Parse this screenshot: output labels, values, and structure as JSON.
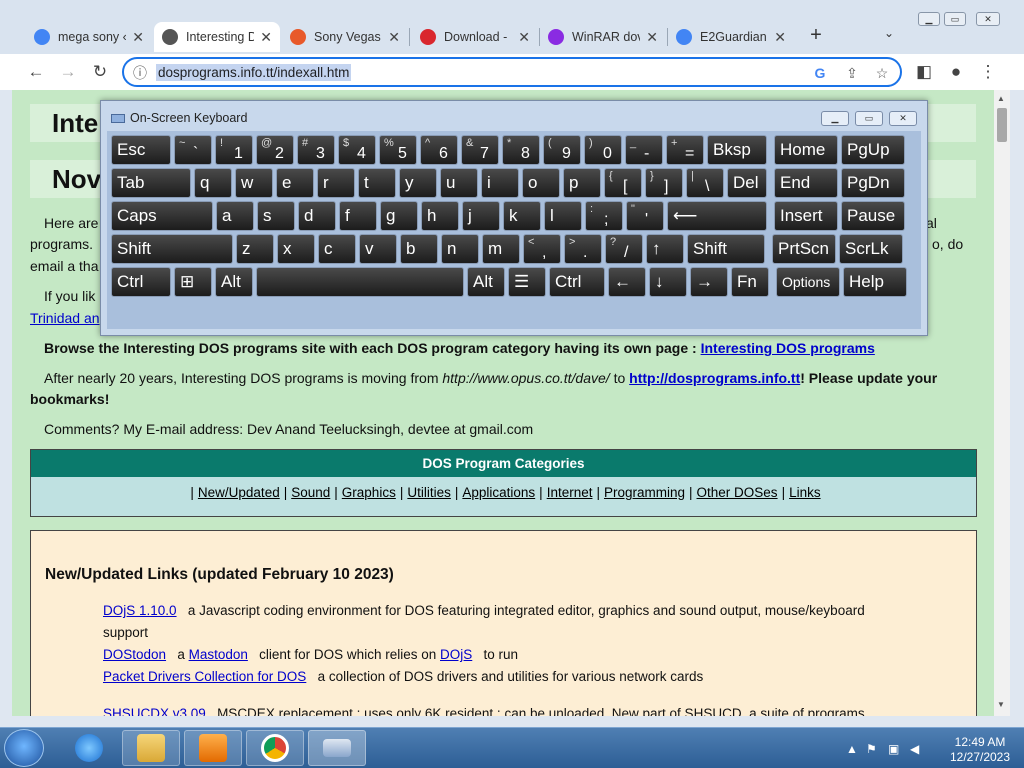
{
  "browser": {
    "tabs": [
      {
        "label": "mega sony «",
        "icon": "google-icon",
        "color": "#4285f4"
      },
      {
        "label": "Interesting D",
        "icon": "globe-icon",
        "color": "#555555",
        "active": true
      },
      {
        "label": "Sony Vegas",
        "icon": "download-icon",
        "color": "#e8592a"
      },
      {
        "label": "Download -",
        "icon": "mega-icon",
        "color": "#d9272e"
      },
      {
        "label": "WinRAR dov",
        "icon": "winrar-icon",
        "color": "#8a2be2"
      },
      {
        "label": "E2Guardian",
        "icon": "google-icon",
        "color": "#4285f4"
      }
    ],
    "new_tab": "+",
    "tab_list": "⌄",
    "url": "dosprograms.info.tt/indexall.htm"
  },
  "page": {
    "banner1": "Inte",
    "banner2": "Nov",
    "intro_start": "Here are",
    "intro_end": "al",
    "intro2_start": "programs.",
    "intro2_end": "o, do",
    "intro3": "email a tha",
    "ifyou": "If you lik",
    "trinidad": "Trinidad an",
    "browse_text": "Browse the Interesting DOS programs site with each DOS program category having its own page :",
    "browse_link": "Interesting DOS programs",
    "moving_text1": "After nearly 20 years, Interesting DOS programs is moving from",
    "moving_old_url": "http://www.opus.co.tt/dave/",
    "moving_to": "to",
    "moving_link": "http://dosprograms.info.tt",
    "moving_text2": "! Please update your",
    "moving_text3": "bookmarks!",
    "comments": "Comments? My E-mail address: Dev Anand Teelucksingh, devtee at gmail.com",
    "categories_title": "DOS Program Categories",
    "categories": [
      "New/Updated",
      "Sound",
      "Graphics",
      "Utilities",
      "Applications",
      "Internet",
      "Programming",
      "Other DOSes",
      "Links"
    ],
    "new_heading": "New/Updated Links (updated February 10 2023)",
    "entries": [
      {
        "link": "DOjS 1.10.0",
        "text": "a Javascript coding environment for DOS featuring integrated editor, graphics and sound output, mouse/keyboard"
      },
      {
        "link": "",
        "text": "support"
      },
      {
        "link": "DOStodon",
        "text": "a",
        "link2": "Mastodon",
        "text2": "client for DOS which relies on",
        "link3": "DOjS",
        "text3": "to run"
      },
      {
        "link": "Packet Drivers Collection for DOS",
        "text": "a collection of DOS drivers and utilities for various network cards"
      },
      {
        "link": "SHSUCDX v3.09",
        "text": "MSCDEX replacement : uses only 6K resident : can be unloaded. New part of SHSUCD, a suite of programs"
      }
    ]
  },
  "osk": {
    "title": "On-Screen Keyboard",
    "rows": [
      [
        {
          "k": "Esc"
        },
        {
          "s": "~",
          "m": "`"
        },
        {
          "s": "!",
          "m": "1"
        },
        {
          "s": "@",
          "m": "2"
        },
        {
          "s": "#",
          "m": "3"
        },
        {
          "s": "$",
          "m": "4"
        },
        {
          "s": "%",
          "m": "5"
        },
        {
          "s": "^",
          "m": "6"
        },
        {
          "s": "&",
          "m": "7"
        },
        {
          "s": "*",
          "m": "8"
        },
        {
          "s": "(",
          "m": "9"
        },
        {
          "s": ")",
          "m": "0"
        },
        {
          "s": "_",
          "m": "-"
        },
        {
          "s": "+",
          "m": "="
        },
        {
          "k": "Bksp"
        },
        {
          "k": "Home"
        },
        {
          "k": "PgUp"
        }
      ],
      [
        {
          "k": "Tab"
        },
        {
          "k": "q"
        },
        {
          "k": "w"
        },
        {
          "k": "e"
        },
        {
          "k": "r"
        },
        {
          "k": "t"
        },
        {
          "k": "y"
        },
        {
          "k": "u"
        },
        {
          "k": "i"
        },
        {
          "k": "o"
        },
        {
          "k": "p"
        },
        {
          "s": "{",
          "m": "["
        },
        {
          "s": "}",
          "m": "]"
        },
        {
          "s": "|",
          "m": "\\"
        },
        {
          "k": "Del"
        },
        {
          "k": "End"
        },
        {
          "k": "PgDn"
        }
      ],
      [
        {
          "k": "Caps"
        },
        {
          "k": "a"
        },
        {
          "k": "s"
        },
        {
          "k": "d"
        },
        {
          "k": "f"
        },
        {
          "k": "g"
        },
        {
          "k": "h"
        },
        {
          "k": "j"
        },
        {
          "k": "k"
        },
        {
          "k": "l"
        },
        {
          "s": ":",
          "m": ";"
        },
        {
          "s": "\"",
          "m": "'"
        },
        {
          "k": "⟵"
        },
        {
          "k": "Insert"
        },
        {
          "k": "Pause"
        }
      ],
      [
        {
          "k": "Shift"
        },
        {
          "k": "z"
        },
        {
          "k": "x"
        },
        {
          "k": "c"
        },
        {
          "k": "v"
        },
        {
          "k": "b"
        },
        {
          "k": "n"
        },
        {
          "k": "m"
        },
        {
          "s": "<",
          "m": ","
        },
        {
          "s": ">",
          "m": "."
        },
        {
          "s": "?",
          "m": "/"
        },
        {
          "k": "↑"
        },
        {
          "k": "Shift"
        },
        {
          "k": "PrtScn"
        },
        {
          "k": "ScrLk"
        }
      ],
      [
        {
          "k": "Ctrl"
        },
        {
          "k": "⊞"
        },
        {
          "k": "Alt"
        },
        {
          "k": ""
        },
        {
          "k": "Alt"
        },
        {
          "k": "☰"
        },
        {
          "k": "Ctrl"
        },
        {
          "k": "←"
        },
        {
          "k": "↓"
        },
        {
          "k": "→"
        },
        {
          "k": "Fn"
        },
        {
          "k": "Options"
        },
        {
          "k": "Help"
        }
      ]
    ]
  },
  "taskbar": {
    "time": "12:49 AM",
    "date": "12/27/2023"
  }
}
